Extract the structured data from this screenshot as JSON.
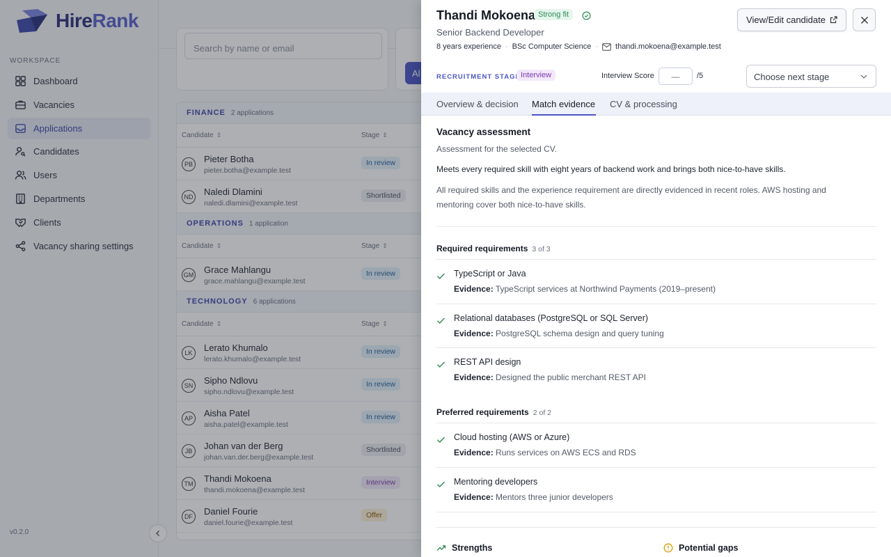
{
  "sidebar": {
    "brand_hire": "Hire",
    "brand_rank": "Rank",
    "section": "WORKSPACE",
    "items": [
      {
        "label": "Dashboard",
        "icon": "dashboard-icon"
      },
      {
        "label": "Vacancies",
        "icon": "briefcase-icon"
      },
      {
        "label": "Applications",
        "icon": "inbox-icon"
      },
      {
        "label": "Candidates",
        "icon": "user-search-icon"
      },
      {
        "label": "Users",
        "icon": "users-icon"
      },
      {
        "label": "Departments",
        "icon": "building-icon"
      },
      {
        "label": "Clients",
        "icon": "handshake-icon"
      },
      {
        "label": "Vacancy sharing settings",
        "icon": "share-icon"
      }
    ],
    "active_index": 2,
    "version": "v0.2.0"
  },
  "main": {
    "search_placeholder": "Search by name or email",
    "filter_button": "Al",
    "col_candidate": "Candidate",
    "col_stage": "Stage",
    "groups": [
      {
        "name": "FINANCE",
        "count": "2 applications",
        "rows": [
          {
            "initials": "PB",
            "name": "Pieter Botha",
            "email": "pieter.botha@example.test",
            "stage": "In review",
            "kind": "review"
          },
          {
            "initials": "ND",
            "name": "Naledi Dlamini",
            "email": "naledi.dlamini@example.test",
            "stage": "Shortlisted",
            "kind": "short"
          }
        ]
      },
      {
        "name": "OPERATIONS",
        "count": "1 application",
        "rows": [
          {
            "initials": "GM",
            "name": "Grace Mahlangu",
            "email": "grace.mahlangu@example.test",
            "stage": "In review",
            "kind": "review"
          }
        ]
      },
      {
        "name": "TECHNOLOGY",
        "count": "6 applications",
        "rows": [
          {
            "initials": "LK",
            "name": "Lerato Khumalo",
            "email": "lerato.khumalo@example.test",
            "stage": "In review",
            "kind": "review"
          },
          {
            "initials": "SN",
            "name": "Sipho Ndlovu",
            "email": "sipho.ndlovu@example.test",
            "stage": "In review",
            "kind": "review"
          },
          {
            "initials": "AP",
            "name": "Aisha Patel",
            "email": "aisha.patel@example.test",
            "stage": "In review",
            "kind": "review"
          },
          {
            "initials": "JB",
            "name": "Johan van der Berg",
            "email": "johan.van.der.berg@example.test",
            "stage": "Shortlisted",
            "kind": "short"
          },
          {
            "initials": "TM",
            "name": "Thandi Mokoena",
            "email": "thandi.mokoena@example.test",
            "stage": "Interview",
            "kind": "interview"
          },
          {
            "initials": "DF",
            "name": "Daniel Fourie",
            "email": "daniel.fourie@example.test",
            "stage": "Offer",
            "kind": "offer"
          }
        ]
      }
    ]
  },
  "drawer": {
    "name": "Thandi Mokoena",
    "fit_badge": "Strong fit",
    "role": "Senior Backend Developer",
    "experience": "8 years experience",
    "education": "BSc Computer Science",
    "email": "thandi.mokoena@example.test",
    "edit_button": "View/Edit candidate",
    "stage_label": "RECRUITMENT STAGE",
    "stage_value": "Interview",
    "score_label": "Interview Score",
    "score_value": "—",
    "score_max": "/5",
    "next_stage_placeholder": "Choose next stage",
    "tabs": [
      "Overview & decision",
      "Match evidence",
      "CV & processing"
    ],
    "active_tab": 1,
    "assessment": {
      "title": "Vacancy assessment",
      "subtitle": "Assessment for the selected CV.",
      "summary": "Meets every required skill with eight years of backend work and brings both nice-to-have skills.",
      "detail": "All required skills and the experience requirement are directly evidenced in recent roles. AWS hosting and mentoring cover both nice-to-have skills."
    },
    "evidence_prefix": "Evidence:",
    "required": {
      "title": "Required requirements",
      "count": "3 of 3",
      "items": [
        {
          "title": "TypeScript or Java",
          "evidence": "TypeScript services at Northwind Payments (2019–present)"
        },
        {
          "title": "Relational databases (PostgreSQL or SQL Server)",
          "evidence": "PostgreSQL schema design and query tuning"
        },
        {
          "title": "REST API design",
          "evidence": "Designed the public merchant REST API"
        }
      ]
    },
    "preferred": {
      "title": "Preferred requirements",
      "count": "2 of 2",
      "items": [
        {
          "title": "Cloud hosting (AWS or Azure)",
          "evidence": "Runs services on AWS ECS and RDS"
        },
        {
          "title": "Mentoring developers",
          "evidence": "Mentors three junior developers"
        }
      ]
    },
    "strengths_title": "Strengths",
    "gaps_title": "Potential gaps"
  },
  "colors": {
    "accent": "#4a55c4",
    "success": "#2d8a54",
    "warning": "#d99a00"
  }
}
